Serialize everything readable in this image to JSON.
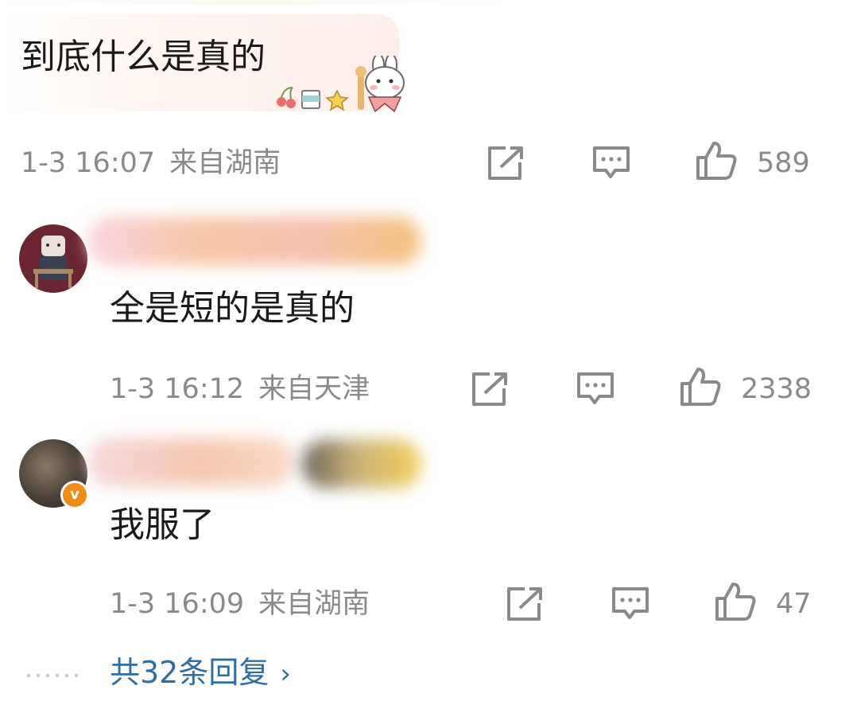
{
  "comments": [
    {
      "text": "到底什么是真的",
      "time": "1-3 16:07",
      "location": "来自湖南",
      "likes": "589",
      "has_avatar": false,
      "decoration": "bunny-sticker-icon"
    },
    {
      "text": "全是短的是真的",
      "time": "1-3 16:12",
      "location": "来自天津",
      "likes": "2338",
      "username_blurred": true
    },
    {
      "text": "我服了",
      "time": "1-3 16:09",
      "location": "来自湖南",
      "likes": "47",
      "username_blurred": true,
      "verified": true
    }
  ],
  "replies_link": "共32条回复",
  "colors": {
    "meta_gray": "#8a8a8a",
    "link_blue": "#2f6ea5",
    "verified_orange": "#f08c16",
    "bubble_pink": "#fdeeea"
  }
}
